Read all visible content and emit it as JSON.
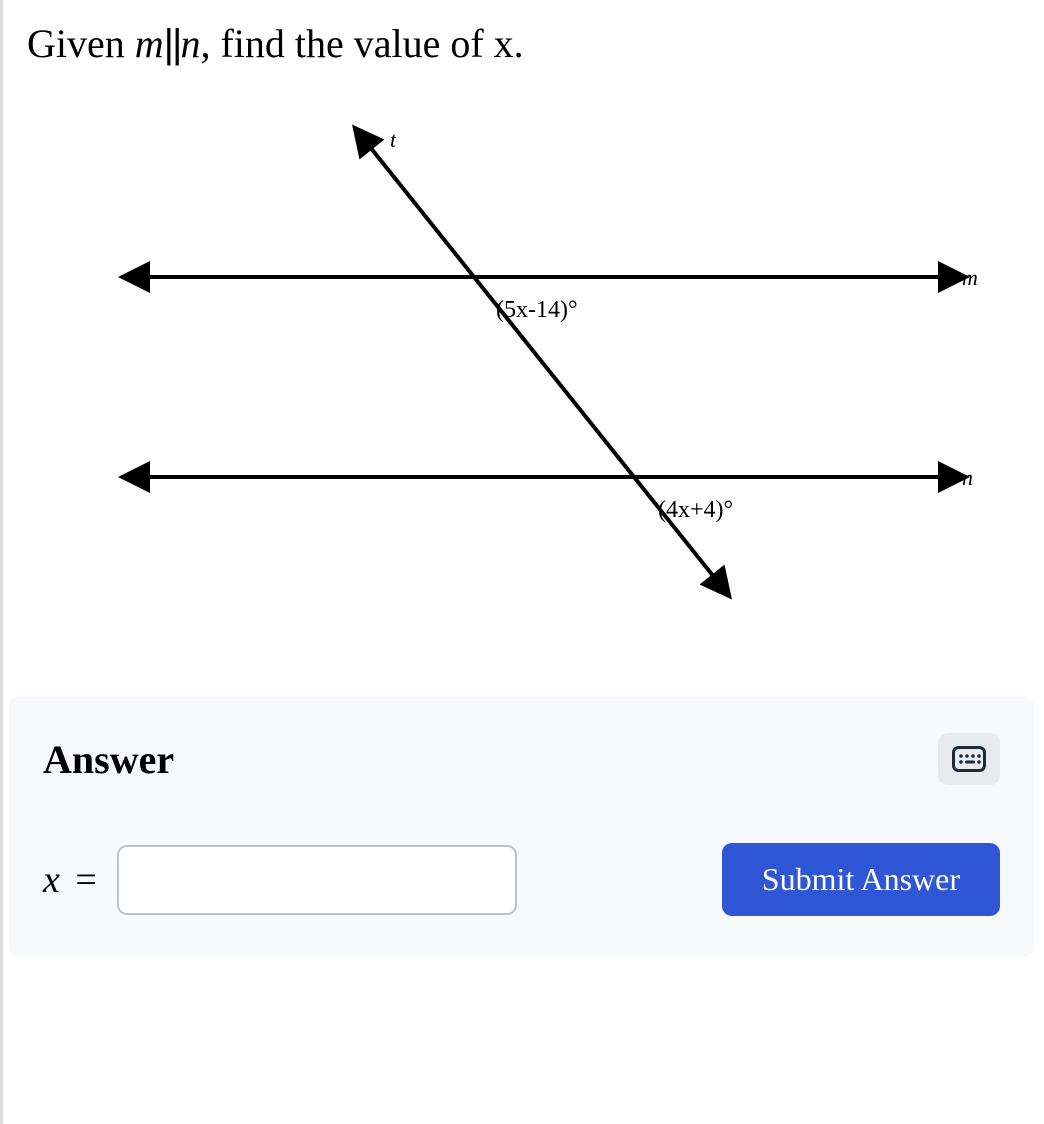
{
  "question": {
    "prefix": "Given ",
    "var1": "m",
    "parallel": "||",
    "var2": "n",
    "suffix": ", find the value of x."
  },
  "diagram": {
    "line_t_label": "t",
    "line_m_label": "m",
    "line_n_label": "n",
    "angle_top": "(5x-14)°",
    "angle_bottom": "(4x+4)°"
  },
  "answer": {
    "heading": "Answer",
    "x_label": "x",
    "equals": "=",
    "input_value": "",
    "submit_label": "Submit Answer"
  }
}
